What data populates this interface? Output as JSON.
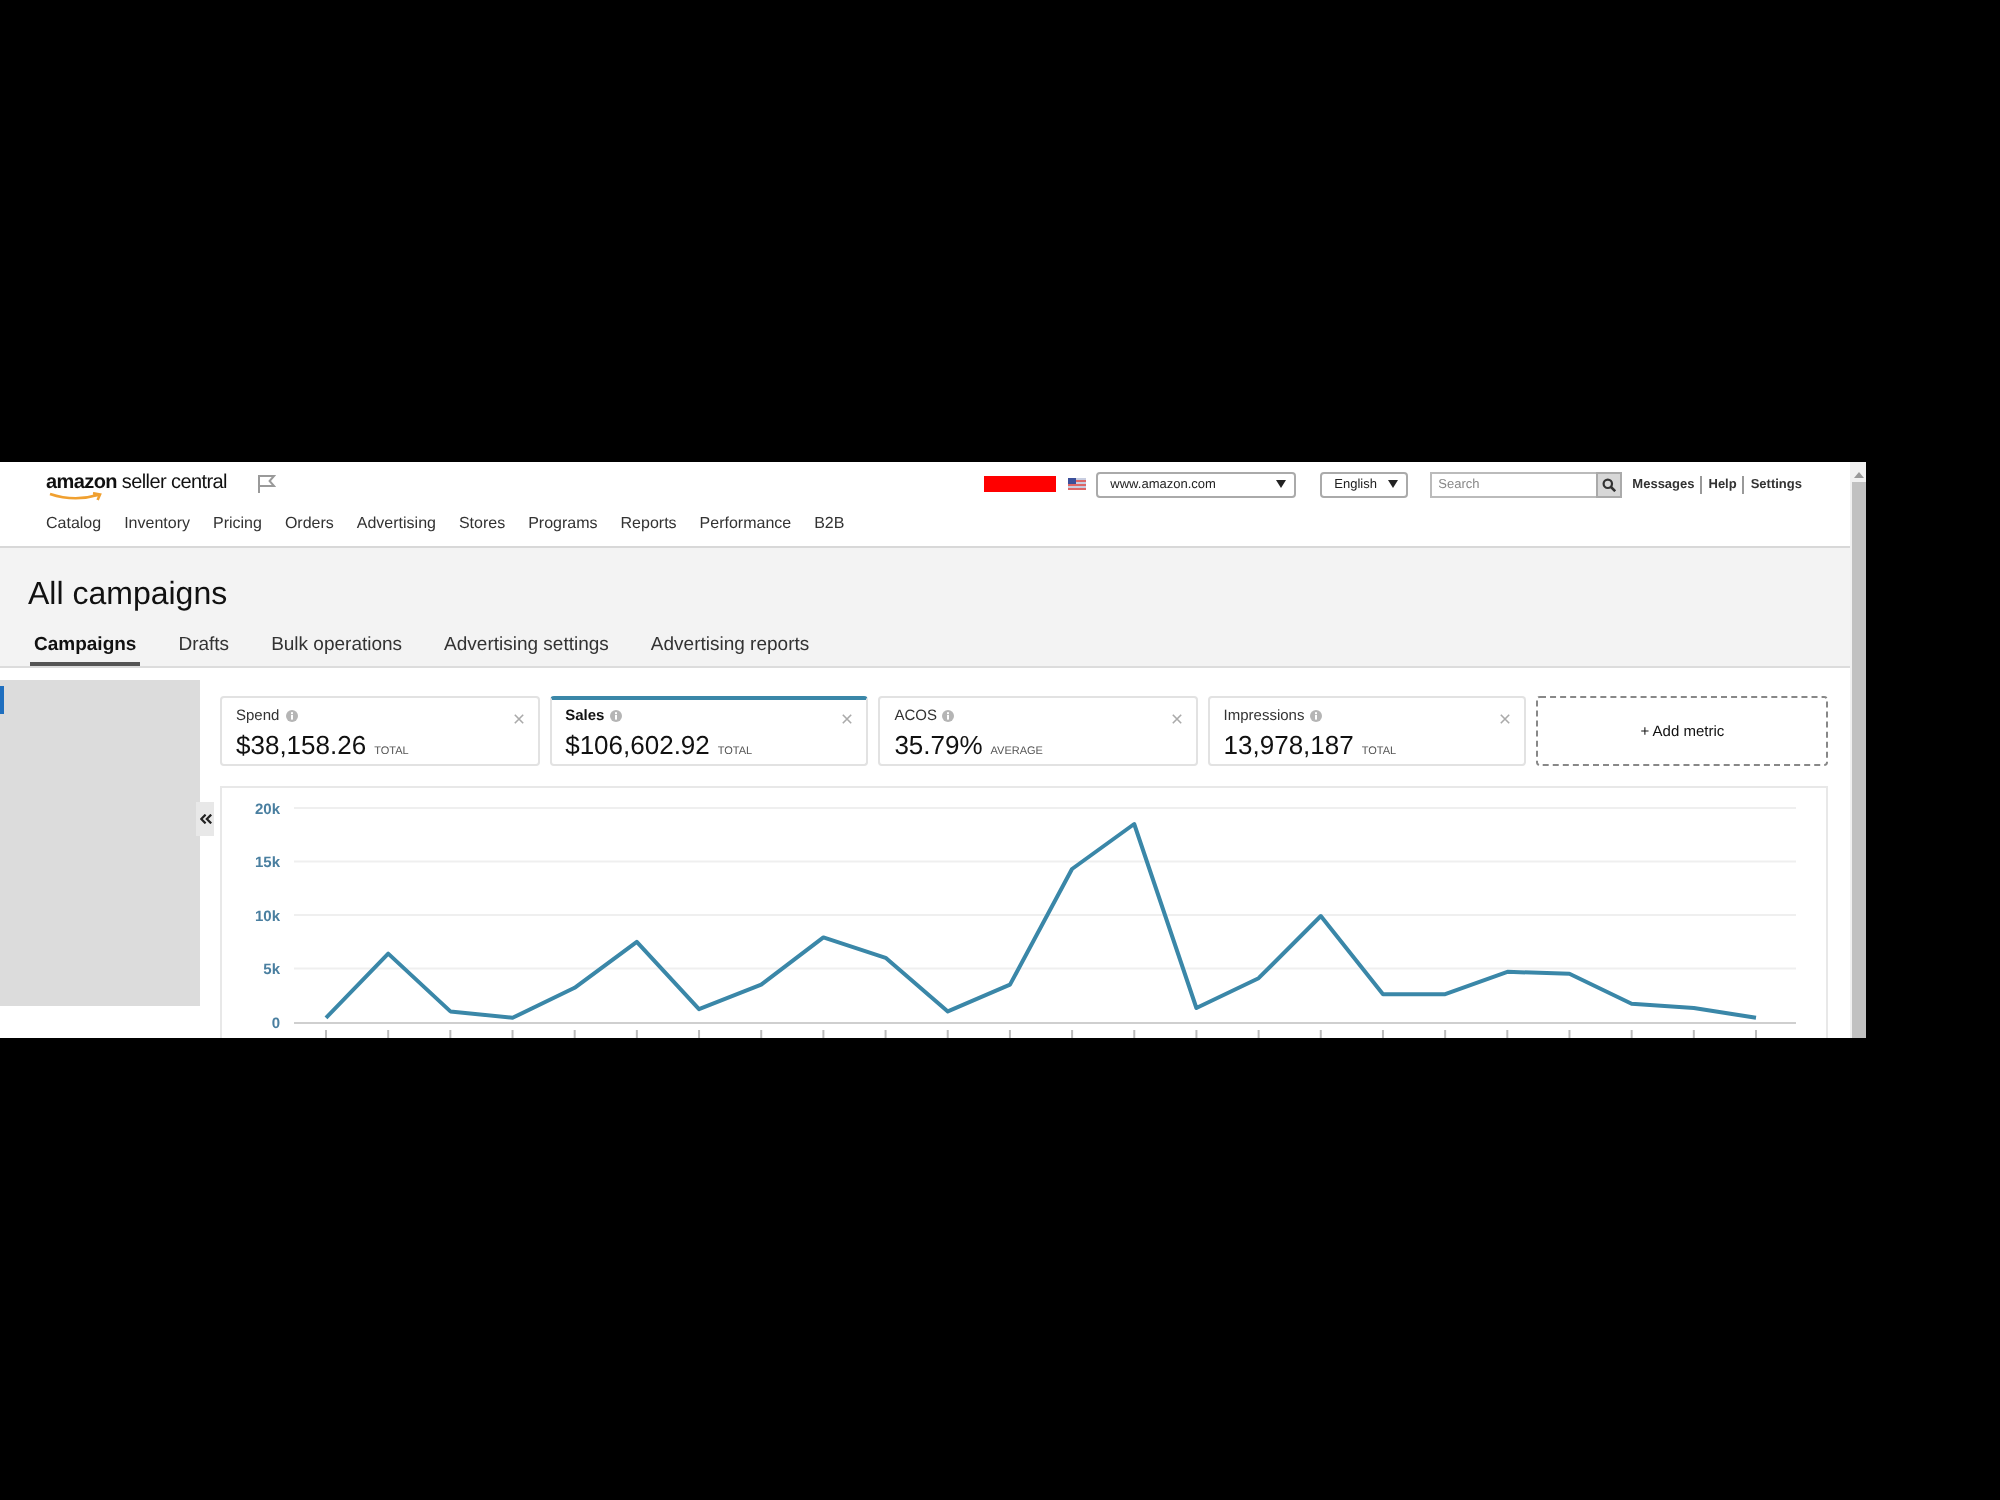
{
  "header": {
    "logo": "**amazon** seller central",
    "marketplace": {
      "value": "www.amazon.com"
    },
    "language": {
      "value": "English"
    },
    "search": {
      "placeholder": "Search"
    },
    "links": [
      "Messages",
      "Help",
      "Settings"
    ]
  },
  "nav": [
    "Catalog",
    "Inventory",
    "Pricing",
    "Orders",
    "Advertising",
    "Stores",
    "Programs",
    "Reports",
    "Performance",
    "B2B"
  ],
  "page": {
    "title": "All campaigns"
  },
  "tabs": [
    {
      "label": "Campaigns",
      "selected": true
    },
    {
      "label": "Drafts",
      "selected": false
    },
    {
      "label": "Bulk operations",
      "selected": false
    },
    {
      "label": "Advertising settings",
      "selected": false
    },
    {
      "label": "Advertising reports",
      "selected": false
    }
  ],
  "metrics": [
    {
      "label": "Spend",
      "value": "$38,158.26",
      "qualifier": "TOTAL",
      "selected": false
    },
    {
      "label": "Sales",
      "value": "$106,602.92",
      "qualifier": "TOTAL",
      "selected": true
    },
    {
      "label": "ACOS",
      "value": "35.79%",
      "qualifier": "AVERAGE",
      "selected": false
    },
    {
      "label": "Impressions",
      "value": "13,978,187",
      "qualifier": "TOTAL",
      "selected": false
    }
  ],
  "add_metric": {
    "label": "+ Add metric"
  },
  "chart": {
    "chart_data": {
      "type": "line",
      "grid": true,
      "ylim": [
        0,
        20000
      ],
      "yticks": [
        {
          "value": 0,
          "label": "0"
        },
        {
          "value": 5000,
          "label": "5k"
        },
        {
          "value": 10000,
          "label": "10k"
        },
        {
          "value": 15000,
          "label": "15k"
        },
        {
          "value": 20000,
          "label": "20k"
        }
      ],
      "series": [
        {
          "color": "#3a87a8",
          "values": [
            400,
            6400,
            1000,
            400,
            3200,
            7500,
            1200,
            3500,
            7900,
            6000,
            1000,
            3500,
            14300,
            18500,
            1300,
            4100,
            9900,
            2600,
            2600,
            4700,
            4500,
            1700,
            1300,
            400
          ]
        }
      ]
    }
  }
}
